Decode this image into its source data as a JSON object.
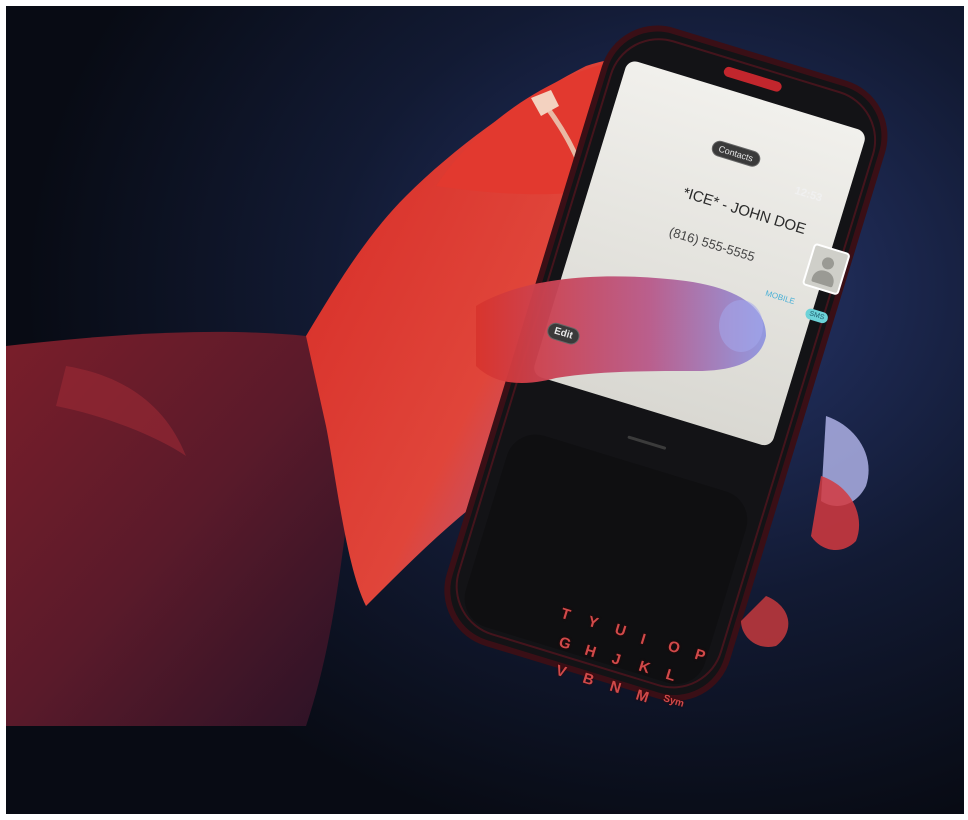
{
  "photo": {
    "subject": "hand holding a slide-out smartphone showing a contact card",
    "colors": {
      "background": "#0c111c",
      "skin_warm": "#e0332b",
      "skin_cool": "#7d86d6",
      "phone_body": "#141416",
      "screen": "#e7e6e2",
      "key_letters": "#d04a4a"
    }
  },
  "phone_screen": {
    "app_button": "Contacts",
    "clock": "12:53",
    "contact_name": "*ICE* - JOHN DOE",
    "phone_number": "(816) 555-5555",
    "number_type": "MOBILE",
    "sms_button": "SMS",
    "edit_button": "Edit"
  },
  "keyboard": {
    "keys": [
      "T",
      "Y",
      "U",
      "I",
      "O",
      "P",
      "G",
      "H",
      "J",
      "K",
      "L",
      "V",
      "B",
      "N",
      "M",
      "Sym"
    ]
  }
}
